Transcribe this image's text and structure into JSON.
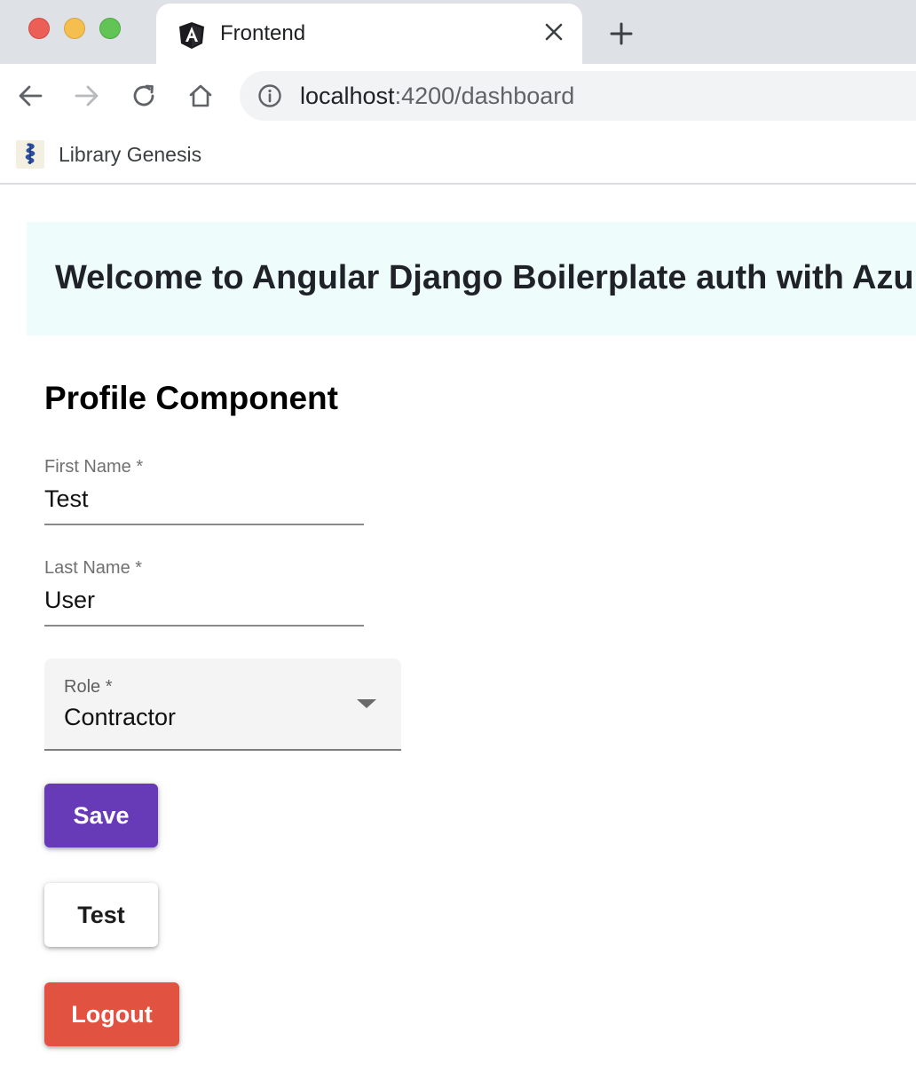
{
  "browser": {
    "tab": {
      "title": "Frontend",
      "favicon": "angular-icon"
    },
    "address_bar": {
      "host": "localhost",
      "rest": ":4200/dashboard"
    },
    "bookmarks": [
      {
        "label": "Library Genesis",
        "icon": "library-genesis-icon"
      }
    ]
  },
  "page": {
    "banner": {
      "text": "Welcome to Angular Django Boilerplate auth with Azure"
    },
    "profile": {
      "title": "Profile Component",
      "first_name": {
        "label": "First Name *",
        "value": "Test"
      },
      "last_name": {
        "label": "Last Name *",
        "value": "User"
      },
      "role": {
        "label": "Role *",
        "value": "Contractor"
      }
    },
    "buttons": {
      "save": "Save",
      "test": "Test",
      "logout": "Logout"
    }
  },
  "colors": {
    "primary": "#673ab7",
    "warn": "#e25241",
    "banner_bg": "#effcfc"
  }
}
